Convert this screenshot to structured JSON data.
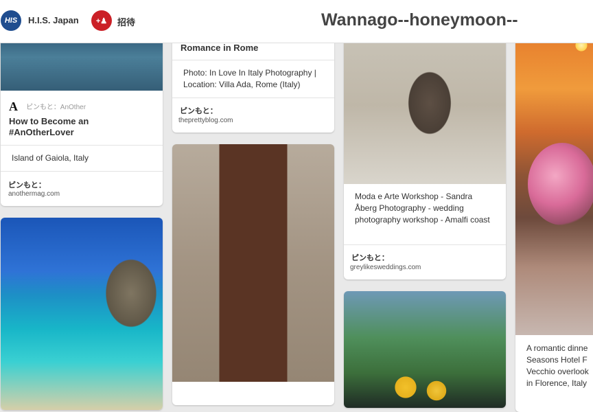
{
  "header": {
    "brand_logo": "HIS",
    "brand_name": "H.I.S. Japan",
    "invite_icon_text": "+♟",
    "invite_label": "招待",
    "board_title": "Wannago--honeymoon--"
  },
  "source_label": "ピンもと：",
  "pins": {
    "sea": {},
    "gaiola": {
      "attribution_logo": "A",
      "attribution_text": "ピンもと：AnOther",
      "title": "How to Become an #AnOtherLover",
      "description": "Island of Gaiola, Italy",
      "source_domain": "anothermag.com"
    },
    "beach": {},
    "rome": {
      "title": "Romance in Rome",
      "description": "Photo: In Love In Italy Photography | Location: Villa Ada, Rome (Italy)",
      "source_domain": "theprettyblog.com"
    },
    "door": {},
    "workshop": {
      "description": "Moda e Arte Workshop - Sandra Åberg Photography - wedding photography workshop - Amalfi coast",
      "source_domain": "greylikesweddings.com"
    },
    "lemons": {},
    "florence": {
      "description": "A romantic dinne Seasons Hotel F Vecchio overlook in Florence, Italy"
    }
  }
}
